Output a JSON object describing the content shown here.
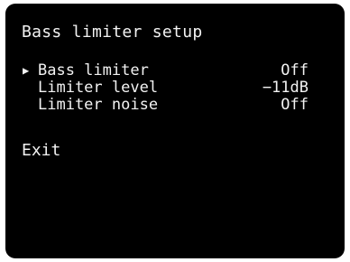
{
  "menu_title": "Bass limiter setup",
  "cursor_icon": "▶",
  "items": [
    {
      "label": "Bass limiter",
      "value": "Off",
      "selected": true
    },
    {
      "label": "Limiter level",
      "value": "−11dB",
      "selected": false
    },
    {
      "label": "Limiter noise",
      "value": "Off",
      "selected": false
    }
  ],
  "exit_label": "Exit",
  "colors": {
    "background": "#000000",
    "text": "#f2f2f2"
  }
}
